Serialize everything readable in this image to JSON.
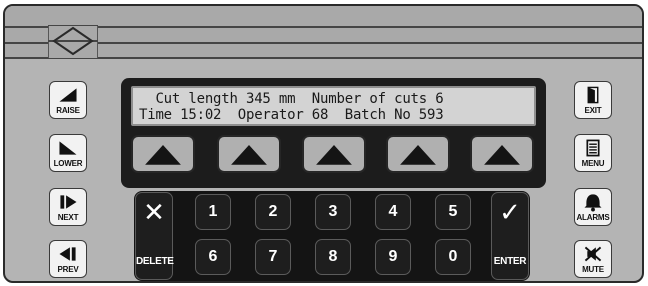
{
  "display": {
    "line1": "  Cut length 345 mm  Number of cuts 6",
    "line2": "Time 15:02  Operator 68  Batch No 593"
  },
  "left_buttons": [
    {
      "label": "RAISE",
      "icon": "raise-ramp-icon"
    },
    {
      "label": "LOWER",
      "icon": "lower-ramp-icon"
    },
    {
      "label": "NEXT",
      "icon": "next-icon"
    },
    {
      "label": "PREV",
      "icon": "prev-icon"
    }
  ],
  "right_buttons": [
    {
      "label": "EXIT",
      "icon": "exit-door-icon"
    },
    {
      "label": "MENU",
      "icon": "menu-list-icon"
    },
    {
      "label": "ALARMS",
      "icon": "bell-icon"
    },
    {
      "label": "MUTE",
      "icon": "mute-speaker-icon"
    }
  ],
  "softkeys": [
    {
      "icon": "up-triangle-icon"
    },
    {
      "icon": "up-triangle-icon"
    },
    {
      "icon": "up-triangle-icon"
    },
    {
      "icon": "up-triangle-icon"
    },
    {
      "icon": "up-triangle-icon"
    }
  ],
  "keypad": {
    "delete_label": "DELETE",
    "delete_glyph": "✕",
    "enter_label": "ENTER",
    "enter_glyph": "✓",
    "row1": [
      "1",
      "2",
      "3",
      "4",
      "5"
    ],
    "row2": [
      "6",
      "7",
      "8",
      "9",
      "0"
    ]
  },
  "colors": {
    "panel": "#b4b4b4",
    "keypad_background": "#141414",
    "key": "#1e1e1e",
    "lcd": "#d3d3d3",
    "button_face": "#f2f2f2"
  }
}
